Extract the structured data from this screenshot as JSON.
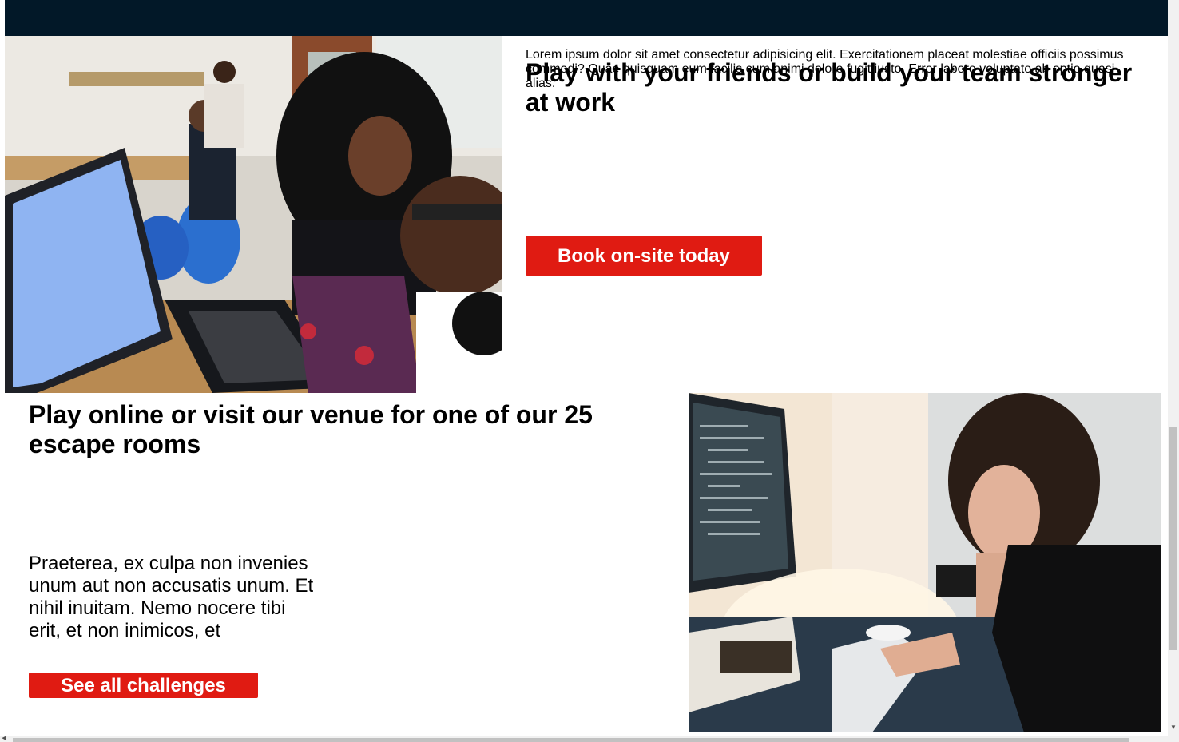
{
  "colors": {
    "topbar": "#021828",
    "accent": "#e01b12",
    "button_text": "#ffffff"
  },
  "section_one": {
    "image_description": "team-at-computers-photo",
    "lorem": "Lorem ipsum dolor sit amet consectetur adipisicing elit. Exercitationem placeat molestiae officiis possimus commodi? Quae quisquam eum facilis cum animi dolore fugit iusto. Error labore voluptate ab optio quasi alias.",
    "heading": "Play with your friends or build your team stronger at work",
    "button_label": "Book on-site today"
  },
  "section_two": {
    "image_description": "developer-at-desk-photo",
    "heading": "Play online or visit our venue for one of our 25 escape rooms",
    "paragraph": "Praeterea, ex culpa non invenies unum aut non accusatis unum. Et nihil inuitam. Nemo nocere tibi erit, et non inimicos, et",
    "button_label": "See all challenges"
  },
  "scrollbars": {
    "vertical_down_icon": "triangle-down-icon",
    "horizontal_left_icon": "triangle-left-icon",
    "vertical_down_glyph": "▼",
    "horizontal_left_glyph": "◀"
  }
}
